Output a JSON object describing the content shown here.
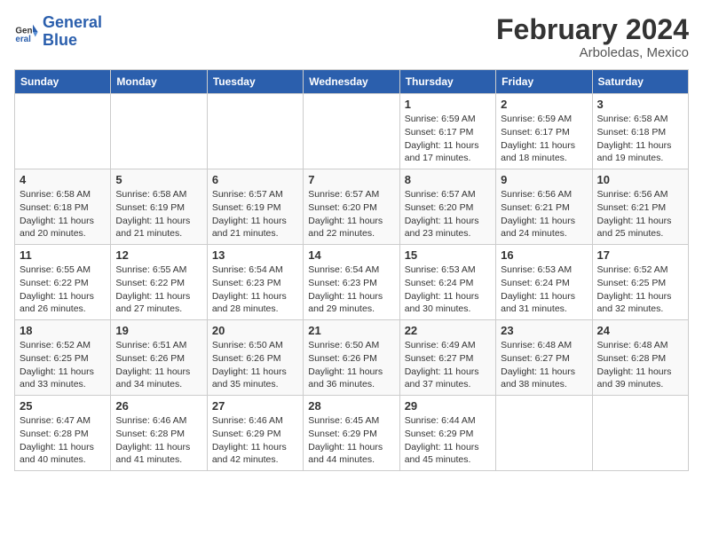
{
  "header": {
    "logo_line1": "General",
    "logo_line2": "Blue",
    "title": "February 2024",
    "subtitle": "Arboledas, Mexico"
  },
  "weekdays": [
    "Sunday",
    "Monday",
    "Tuesday",
    "Wednesday",
    "Thursday",
    "Friday",
    "Saturday"
  ],
  "weeks": [
    [
      {
        "day": "",
        "info": ""
      },
      {
        "day": "",
        "info": ""
      },
      {
        "day": "",
        "info": ""
      },
      {
        "day": "",
        "info": ""
      },
      {
        "day": "1",
        "info": "Sunrise: 6:59 AM\nSunset: 6:17 PM\nDaylight: 11 hours\nand 17 minutes."
      },
      {
        "day": "2",
        "info": "Sunrise: 6:59 AM\nSunset: 6:17 PM\nDaylight: 11 hours\nand 18 minutes."
      },
      {
        "day": "3",
        "info": "Sunrise: 6:58 AM\nSunset: 6:18 PM\nDaylight: 11 hours\nand 19 minutes."
      }
    ],
    [
      {
        "day": "4",
        "info": "Sunrise: 6:58 AM\nSunset: 6:18 PM\nDaylight: 11 hours\nand 20 minutes."
      },
      {
        "day": "5",
        "info": "Sunrise: 6:58 AM\nSunset: 6:19 PM\nDaylight: 11 hours\nand 21 minutes."
      },
      {
        "day": "6",
        "info": "Sunrise: 6:57 AM\nSunset: 6:19 PM\nDaylight: 11 hours\nand 21 minutes."
      },
      {
        "day": "7",
        "info": "Sunrise: 6:57 AM\nSunset: 6:20 PM\nDaylight: 11 hours\nand 22 minutes."
      },
      {
        "day": "8",
        "info": "Sunrise: 6:57 AM\nSunset: 6:20 PM\nDaylight: 11 hours\nand 23 minutes."
      },
      {
        "day": "9",
        "info": "Sunrise: 6:56 AM\nSunset: 6:21 PM\nDaylight: 11 hours\nand 24 minutes."
      },
      {
        "day": "10",
        "info": "Sunrise: 6:56 AM\nSunset: 6:21 PM\nDaylight: 11 hours\nand 25 minutes."
      }
    ],
    [
      {
        "day": "11",
        "info": "Sunrise: 6:55 AM\nSunset: 6:22 PM\nDaylight: 11 hours\nand 26 minutes."
      },
      {
        "day": "12",
        "info": "Sunrise: 6:55 AM\nSunset: 6:22 PM\nDaylight: 11 hours\nand 27 minutes."
      },
      {
        "day": "13",
        "info": "Sunrise: 6:54 AM\nSunset: 6:23 PM\nDaylight: 11 hours\nand 28 minutes."
      },
      {
        "day": "14",
        "info": "Sunrise: 6:54 AM\nSunset: 6:23 PM\nDaylight: 11 hours\nand 29 minutes."
      },
      {
        "day": "15",
        "info": "Sunrise: 6:53 AM\nSunset: 6:24 PM\nDaylight: 11 hours\nand 30 minutes."
      },
      {
        "day": "16",
        "info": "Sunrise: 6:53 AM\nSunset: 6:24 PM\nDaylight: 11 hours\nand 31 minutes."
      },
      {
        "day": "17",
        "info": "Sunrise: 6:52 AM\nSunset: 6:25 PM\nDaylight: 11 hours\nand 32 minutes."
      }
    ],
    [
      {
        "day": "18",
        "info": "Sunrise: 6:52 AM\nSunset: 6:25 PM\nDaylight: 11 hours\nand 33 minutes."
      },
      {
        "day": "19",
        "info": "Sunrise: 6:51 AM\nSunset: 6:26 PM\nDaylight: 11 hours\nand 34 minutes."
      },
      {
        "day": "20",
        "info": "Sunrise: 6:50 AM\nSunset: 6:26 PM\nDaylight: 11 hours\nand 35 minutes."
      },
      {
        "day": "21",
        "info": "Sunrise: 6:50 AM\nSunset: 6:26 PM\nDaylight: 11 hours\nand 36 minutes."
      },
      {
        "day": "22",
        "info": "Sunrise: 6:49 AM\nSunset: 6:27 PM\nDaylight: 11 hours\nand 37 minutes."
      },
      {
        "day": "23",
        "info": "Sunrise: 6:48 AM\nSunset: 6:27 PM\nDaylight: 11 hours\nand 38 minutes."
      },
      {
        "day": "24",
        "info": "Sunrise: 6:48 AM\nSunset: 6:28 PM\nDaylight: 11 hours\nand 39 minutes."
      }
    ],
    [
      {
        "day": "25",
        "info": "Sunrise: 6:47 AM\nSunset: 6:28 PM\nDaylight: 11 hours\nand 40 minutes."
      },
      {
        "day": "26",
        "info": "Sunrise: 6:46 AM\nSunset: 6:28 PM\nDaylight: 11 hours\nand 41 minutes."
      },
      {
        "day": "27",
        "info": "Sunrise: 6:46 AM\nSunset: 6:29 PM\nDaylight: 11 hours\nand 42 minutes."
      },
      {
        "day": "28",
        "info": "Sunrise: 6:45 AM\nSunset: 6:29 PM\nDaylight: 11 hours\nand 44 minutes."
      },
      {
        "day": "29",
        "info": "Sunrise: 6:44 AM\nSunset: 6:29 PM\nDaylight: 11 hours\nand 45 minutes."
      },
      {
        "day": "",
        "info": ""
      },
      {
        "day": "",
        "info": ""
      }
    ]
  ]
}
